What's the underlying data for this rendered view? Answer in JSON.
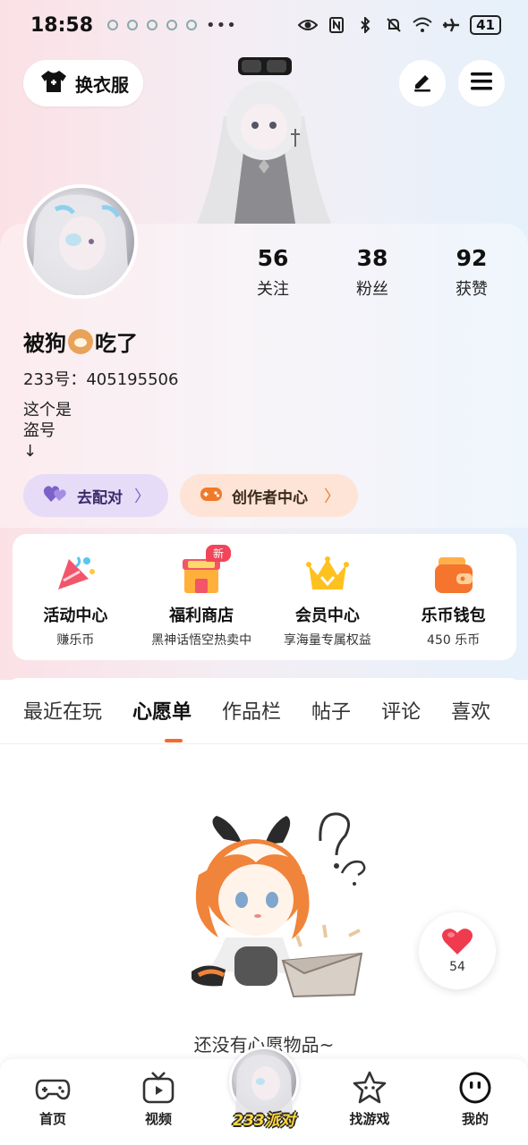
{
  "status_bar": {
    "time": "18:58",
    "overflow": "•••",
    "battery": "41"
  },
  "header": {
    "outfit_label": "换衣服",
    "edit_icon": "pen-icon",
    "menu_icon": "hamburger-menu-icon"
  },
  "profile": {
    "stats": [
      {
        "value": "56",
        "label": "关注"
      },
      {
        "value": "38",
        "label": "粉丝"
      },
      {
        "value": "92",
        "label": "获赞"
      }
    ],
    "name_prefix": "被狗",
    "name_suffix": "吃了",
    "uid": "233号：405195506",
    "bio": "这个是\n盗号\n↓"
  },
  "pills": {
    "match_label": "去配对",
    "creator_label": "创作者中心"
  },
  "features": {
    "new_badge": "新",
    "items": [
      {
        "title": "活动中心",
        "subtitle": "赚乐币"
      },
      {
        "title": "福利商店",
        "subtitle": "黑神话悟空热卖中"
      },
      {
        "title": "会员中心",
        "subtitle": "享海量专属权益"
      },
      {
        "title": "乐币钱包",
        "subtitle": "450 乐币"
      }
    ]
  },
  "tabs": [
    {
      "label": "最近在玩",
      "active": false
    },
    {
      "label": "心愿单",
      "active": true
    },
    {
      "label": "作品栏",
      "active": false
    },
    {
      "label": "帖子",
      "active": false
    },
    {
      "label": "评论",
      "active": false
    },
    {
      "label": "喜欢",
      "active": false
    }
  ],
  "empty_state": {
    "text": "还没有心愿物品~"
  },
  "like_float": {
    "count": "54"
  },
  "bottom_nav": {
    "items": [
      {
        "label": "首页",
        "icon": "gamepad-icon"
      },
      {
        "label": "视频",
        "icon": "tv-icon"
      },
      {
        "label": "找游戏",
        "icon": "star-face-icon"
      },
      {
        "label": "我的",
        "icon": "smile-face-icon"
      }
    ],
    "center_brand": "233派对"
  },
  "colors": {
    "accent_orange": "#f36b2a",
    "new_badge_red": "#f2455a",
    "match_purple": "#7a62c9",
    "heart_red": "#f03a4e"
  }
}
